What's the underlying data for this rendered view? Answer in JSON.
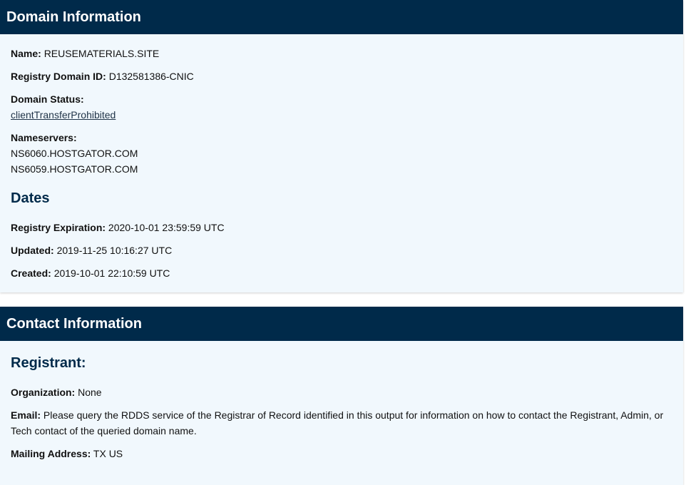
{
  "domain_section": {
    "title": "Domain Information",
    "name_label": "Name:",
    "name_value": "REUSEMATERIALS.SITE",
    "registry_id_label": "Registry Domain ID:",
    "registry_id_value": "D132581386-CNIC",
    "status_label": "Domain Status:",
    "status_value": "clientTransferProhibited",
    "nameservers_label": "Nameservers:",
    "nameservers": [
      "NS6060.HOSTGATOR.COM",
      "NS6059.HOSTGATOR.COM"
    ]
  },
  "dates_section": {
    "title": "Dates",
    "expiration_label": "Registry Expiration:",
    "expiration_value": "2020-10-01 23:59:59 UTC",
    "updated_label": "Updated:",
    "updated_value": "2019-11-25 10:16:27 UTC",
    "created_label": "Created:",
    "created_value": "2019-10-01 22:10:59 UTC"
  },
  "contact_section": {
    "title": "Contact Information",
    "registrant_title": "Registrant:",
    "organization_label": "Organization:",
    "organization_value": "None",
    "email_label": "Email:",
    "email_value": "Please query the RDDS service of the Registrar of Record identified in this output for information on how to contact the Registrant, Admin, or Tech contact of the queried domain name.",
    "address_label": "Mailing Address:",
    "address_value": "TX US"
  },
  "colors": {
    "header_bg": "#002a4a",
    "card_bg": "#f1f8fd",
    "heading_text": "#002a4a"
  }
}
